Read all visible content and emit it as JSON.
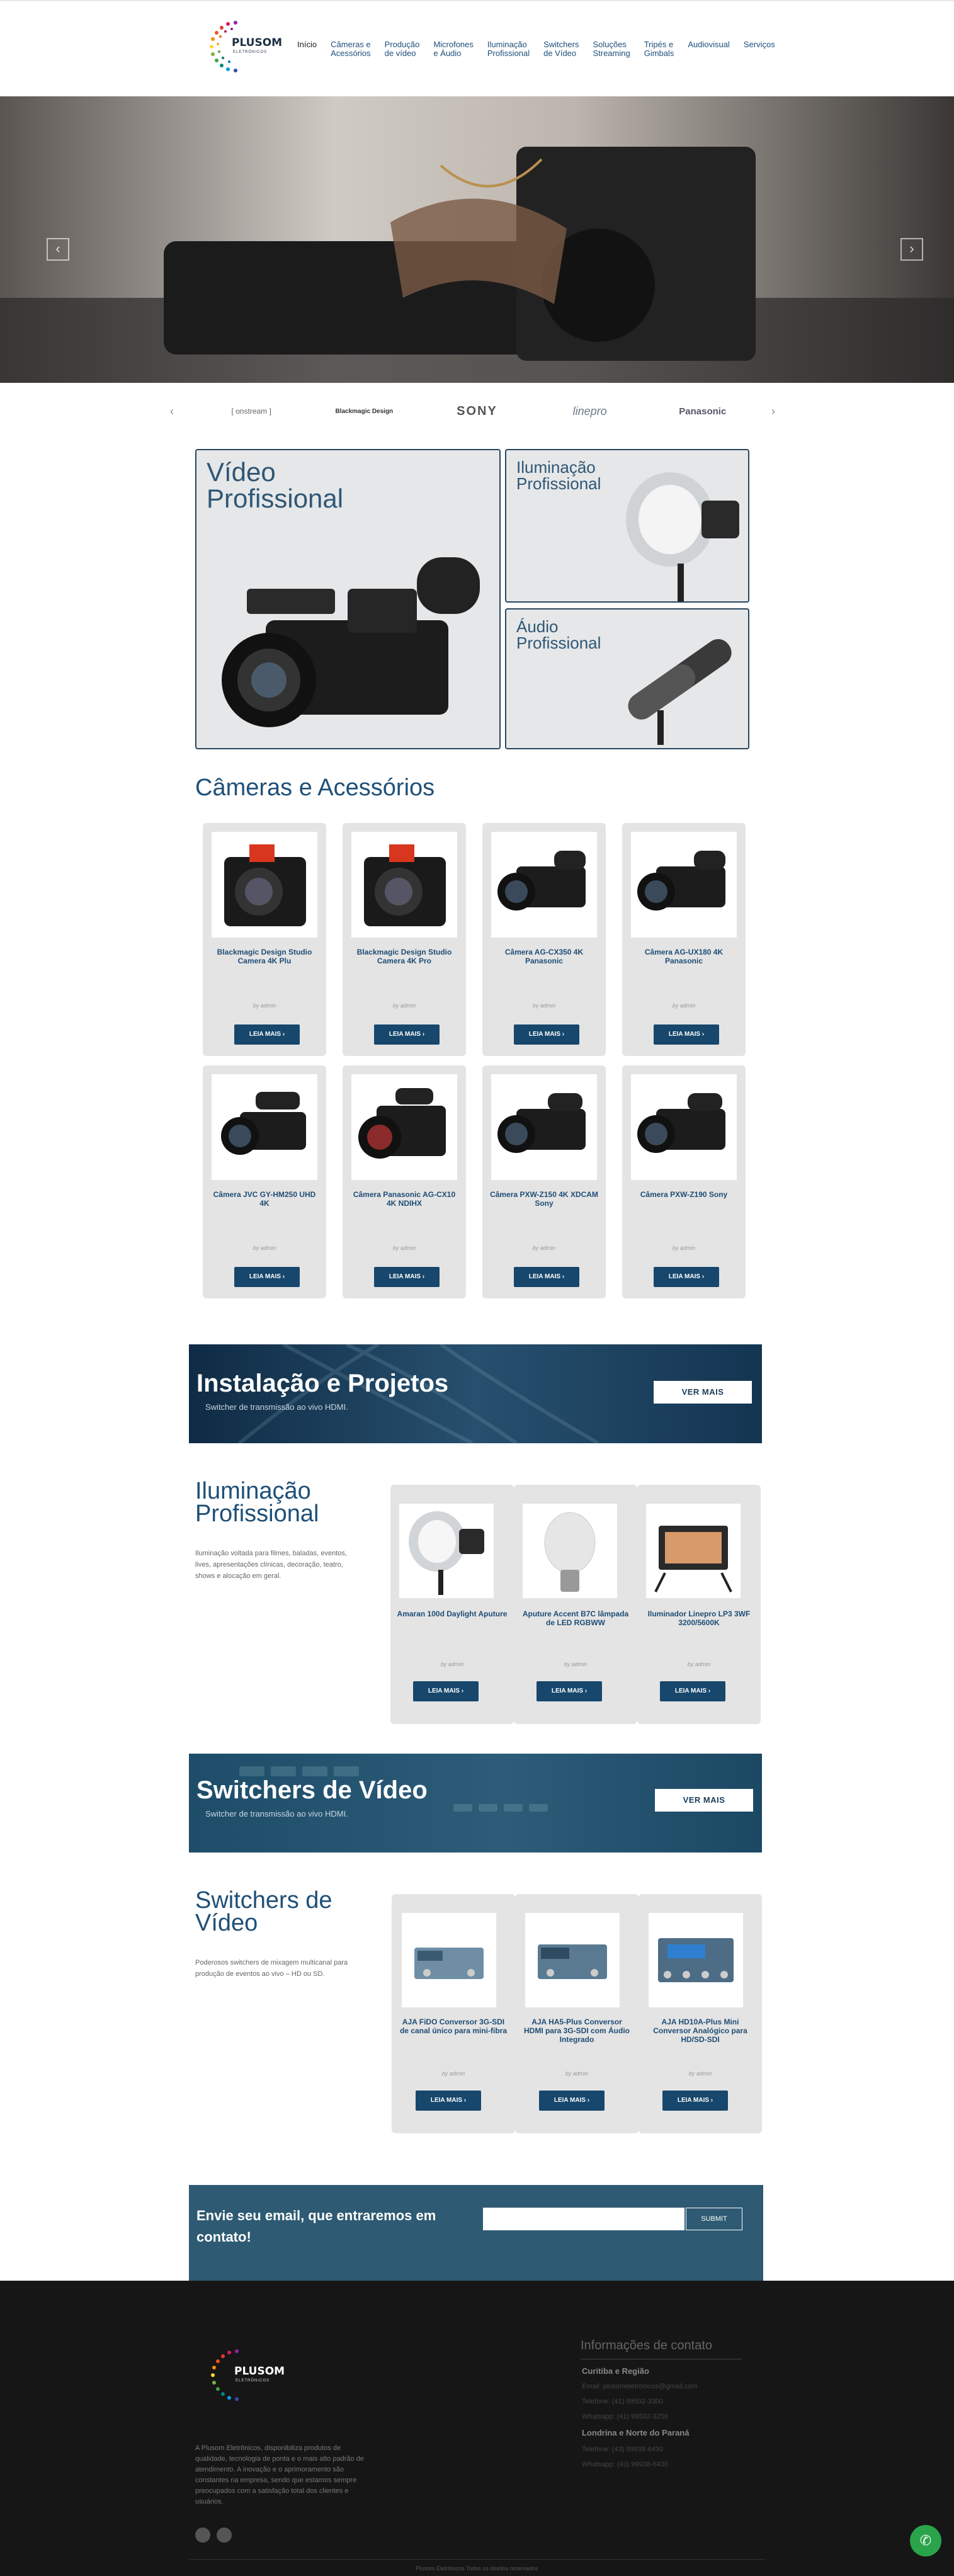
{
  "header": {
    "brand": "PLUSOM",
    "brand_sub": "ELETRÔNICOS",
    "nav": [
      {
        "label": "Início"
      },
      {
        "label": "Câmeras e\nAcessórios"
      },
      {
        "label": "Produção\nde vídeo"
      },
      {
        "label": "Microfones\ne Áudio"
      },
      {
        "label": "Iluminação\nProfissional"
      },
      {
        "label": "Switchers\nde Vídeo"
      },
      {
        "label": "Soluções\nStreaming"
      },
      {
        "label": "Tripés e\nGimbals"
      },
      {
        "label": "Audiovisual"
      },
      {
        "label": "Serviços"
      }
    ]
  },
  "hero": {
    "prev": "‹",
    "next": "›"
  },
  "brands": [
    "[ onstream ]",
    "Blackmagic Design",
    "SONY",
    "linepro",
    "Panasonic"
  ],
  "features": {
    "video": {
      "title": "Vídeo\nProfissional"
    },
    "light": {
      "title": "Iluminação\nProfissional"
    },
    "audio": {
      "title": "Áudio\nProfissional"
    }
  },
  "cameras": {
    "title": "Câmeras e Acessórios",
    "products": [
      {
        "name": "Blackmagic Design Studio Camera 4K Plu",
        "by": "by admin",
        "cta": "LEIA MAIS"
      },
      {
        "name": "Blackmagic Design Studio Camera 4K Pro",
        "by": "by admin",
        "cta": "LEIA MAIS"
      },
      {
        "name": "Câmera AG-CX350 4K Panasonic",
        "by": "by admin",
        "cta": "LEIA MAIS"
      },
      {
        "name": "Câmera AG-UX180 4K Panasonic",
        "by": "by admin",
        "cta": "LEIA MAIS"
      },
      {
        "name": "Câmera JVC GY-HM250 UHD 4K",
        "by": "by admin",
        "cta": "LEIA MAIS"
      },
      {
        "name": "Câmera Panasonic AG-CX10 4K NDIHX",
        "by": "by admin",
        "cta": "LEIA MAIS"
      },
      {
        "name": "Câmera PXW-Z150 4K XDCAM Sony",
        "by": "by admin",
        "cta": "LEIA MAIS"
      },
      {
        "name": "Câmera PXW-Z190 Sony",
        "by": "by admin",
        "cta": "LEIA MAIS"
      }
    ]
  },
  "banner1": {
    "title": "Instalação e Projetos",
    "subtitle": "Switcher de transmissão ao vivo HDMI.",
    "cta": "VER MAIS"
  },
  "lighting": {
    "title": "Iluminação\nProfissional",
    "desc": "Iluminação voltada para filmes, baladas, eventos, lives, apresentações clínicas, decoração, teatro, shows e alocação em geral.",
    "products": [
      {
        "name": "Amaran 100d Daylight Aputure",
        "by": "by admin",
        "cta": "LEIA MAIS"
      },
      {
        "name": "Aputure Accent B7C lâmpada de LED RGBWW",
        "by": "by admin",
        "cta": "LEIA MAIS"
      },
      {
        "name": "Iluminador Linepro LP3 3WF 3200/5600K",
        "by": "by admin",
        "cta": "LEIA MAIS"
      }
    ]
  },
  "banner2": {
    "title": "Switchers de Vídeo",
    "subtitle": "Switcher de transmissão ao vivo HDMI.",
    "cta": "VER MAIS"
  },
  "switchers": {
    "title": "Switchers de\nVídeo",
    "desc": "Poderosos switchers de mixagem multicanal para produção de eventos ao vivo – HD ou SD.",
    "products": [
      {
        "name": "AJA FiDO Conversor 3G-SDI de canal único para mini-fibra",
        "by": "by admin",
        "cta": "LEIA MAIS"
      },
      {
        "name": "AJA HA5-Plus Conversor HDMI para 3G-SDI com Áudio Integrado",
        "by": "by admin",
        "cta": "LEIA MAIS"
      },
      {
        "name": "AJA HD10A-Plus Mini Conversor Analógico para HD/SD-SDI",
        "by": "by admin",
        "cta": "LEIA MAIS"
      }
    ]
  },
  "newsletter": {
    "title": "Envie seu email, que entraremos em contato!",
    "placeholder": "",
    "submit": "SUBMIT"
  },
  "footer": {
    "about": "A Plusom Eletrônicos, disponibiliza produtos de qualidade, tecnologia de ponta e o mais alto padrão de atendimento. A inovação e o aprimoramento são constantes na empresa, sendo que estamos sempre preocupados com a satisfação total dos clientes e usuários.",
    "contact_title": "Informações de contato",
    "region1": "Curitiba e Região",
    "r1_lines": [
      "Email: plusomeletronicos@gmail.com",
      "Telefone: (41) 99502-3300",
      "Whatsapp: (41) 99502-3256"
    ],
    "region2": "Londrina e Norte do Paraná",
    "r2_lines": [
      "Telefone: (43) 99938-6430",
      "Whatsapp: (43) 99938-6430"
    ],
    "copyright": "Plusom Eletrônicos Todos os direitos reservados"
  },
  "colors": {
    "primary": "#17476c",
    "accent": "#2e5a73",
    "footer": "#161616",
    "whatsapp": "#2aa44a"
  }
}
